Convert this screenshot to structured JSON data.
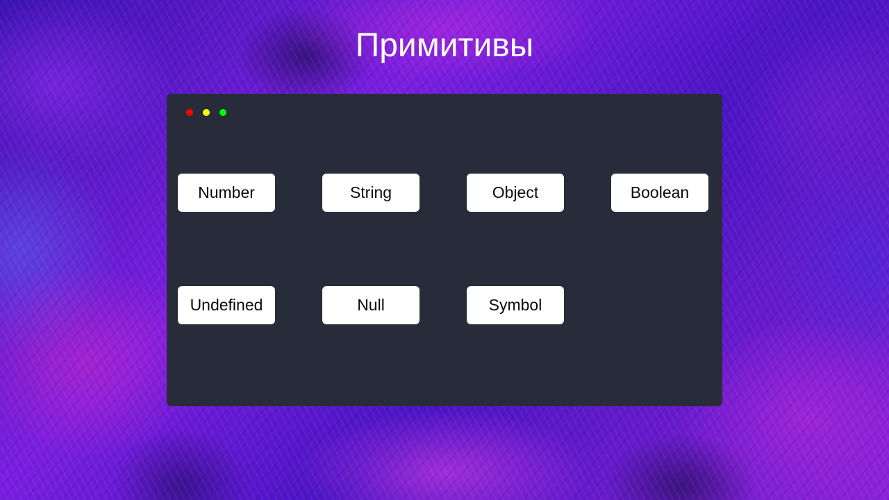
{
  "slide": {
    "title": "Примитивы"
  },
  "window": {
    "controls": {
      "close_color": "#ff0000",
      "minimize_color": "#ffff00",
      "maximize_color": "#00ff00"
    }
  },
  "types": {
    "row1": [
      "Number",
      "String",
      "Object",
      "Boolean"
    ],
    "row2": [
      "Undefined",
      "Null",
      "Symbol"
    ]
  },
  "colors": {
    "window_bg": "#282c3a",
    "chip_bg": "#ffffff",
    "title_text": "#ffffff"
  }
}
